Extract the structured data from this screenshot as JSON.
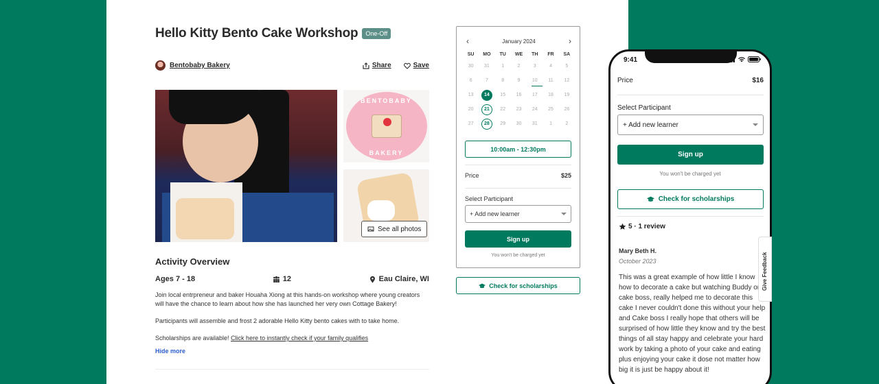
{
  "workshop": {
    "title": "Hello Kitty Bento Cake Workshop",
    "badge": "One-Off",
    "host": "Bentobaby Bakery",
    "share_label": "Share",
    "save_label": "Save",
    "see_all_photos": "See all photos",
    "logo_text_top": "BENTOBABY",
    "logo_text_bottom": "BAKERY"
  },
  "overview": {
    "title": "Activity Overview",
    "ages": "Ages 7 - 18",
    "group_size": "12",
    "location": "Eau Claire, WI",
    "para1": "Join local entrpreneur and baker Houaha Xiong at this hands-on workshop where young creators will have the chance to learn about how she has launched her very own Cottage Bakery!",
    "para2": "Participants will assemble and frost 2 adorable Hello Kitty bento cakes with to take home.",
    "para3_prefix": "Scholarships are available! ",
    "para3_link": "Click here to instantly check if your family qualifies",
    "hide_more": "Hide more"
  },
  "calendar": {
    "month": "January 2024",
    "days_of_week": [
      "SU",
      "MO",
      "TU",
      "WE",
      "TH",
      "FR",
      "SA"
    ],
    "weeks": [
      [
        "30",
        "31",
        "1",
        "2",
        "3",
        "4",
        "5"
      ],
      [
        "6",
        "7",
        "8",
        "9",
        "10",
        "11",
        "12"
      ],
      [
        "13",
        "14",
        "15",
        "16",
        "17",
        "18",
        "19"
      ],
      [
        "20",
        "21",
        "22",
        "23",
        "24",
        "25",
        "26"
      ],
      [
        "27",
        "28",
        "29",
        "30",
        "31",
        "1",
        "2"
      ]
    ],
    "selected_date": "14",
    "available_dates": [
      "21",
      "28"
    ],
    "today_date": "10"
  },
  "booking": {
    "time_slot": "10:00am - 12:30pm",
    "price_label": "Price",
    "price": "$25",
    "participant_label": "Select Participant",
    "participant_value": "+ Add new learner",
    "signup": "Sign up",
    "note": "You won't be charged yet",
    "scholarships": "Check for scholarships"
  },
  "phone": {
    "time": "9:41",
    "price_label": "Price",
    "price": "$16",
    "participant_label": "Select Participant",
    "participant_value": "+ Add new learner",
    "signup": "Sign up",
    "note": "You won't be charged yet",
    "scholarships": "Check for scholarships",
    "rating": "5 · 1 review",
    "reviewer": "Mary Beth H.",
    "review_date": "October 2023",
    "review_text": "This was a great example of how little I know how to decorate a cake but watching Buddy on cake boss, really helped me to decorate this cake I never couldn't done this without your help and Cake boss I really hope that others will be surprised of how little they know and try the best things of all stay happy and celebrate your hard work by taking a photo of your cake and eating plus enjoying your cake it dose not matter how big it is just be happy about it!",
    "feedback_tab": "Give Feedback"
  },
  "colors": {
    "brand_green": "#007A5E",
    "badge": "#5c8f87",
    "link_blue": "#2d5fcf"
  }
}
